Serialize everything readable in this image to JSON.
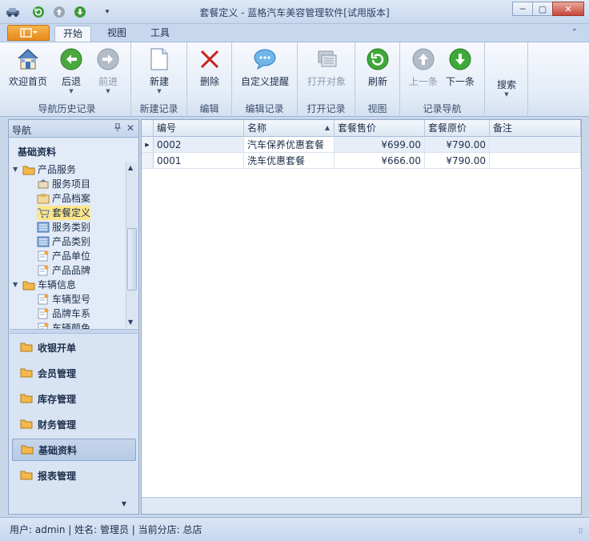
{
  "window": {
    "title": "套餐定义 - 蓝格汽车美容管理软件[试用版本]",
    "minimize_glyph": "─",
    "restore_glyph": "▢",
    "close_glyph": "✕"
  },
  "ribbon_tabs": [
    {
      "label": "开始",
      "active": true
    },
    {
      "label": "视图",
      "active": false
    },
    {
      "label": "工具",
      "active": false
    }
  ],
  "ribbon": {
    "groups": [
      {
        "label": "导航历史记录",
        "buttons": [
          {
            "label": "欢迎首页",
            "icon": "home-icon",
            "disabled": false
          },
          {
            "label": "后退",
            "icon": "back-arrow-icon",
            "disabled": false
          },
          {
            "label": "前进",
            "icon": "forward-arrow-icon",
            "disabled": true
          }
        ]
      },
      {
        "label": "新建记录",
        "buttons": [
          {
            "label": "新建",
            "icon": "new-document-icon",
            "disabled": false
          }
        ]
      },
      {
        "label": "编辑",
        "buttons": [
          {
            "label": "删除",
            "icon": "delete-x-icon",
            "disabled": false
          }
        ]
      },
      {
        "label": "编辑记录",
        "buttons": [
          {
            "label": "自定义提醒",
            "icon": "chat-bubble-icon",
            "disabled": false
          }
        ]
      },
      {
        "label": "打开记录",
        "buttons": [
          {
            "label": "打开对象",
            "icon": "open-object-icon",
            "disabled": true
          }
        ]
      },
      {
        "label": "视图",
        "buttons": [
          {
            "label": "刷新",
            "icon": "refresh-icon",
            "disabled": false
          }
        ]
      },
      {
        "label": "记录导航",
        "buttons": [
          {
            "label": "上一条",
            "icon": "up-arrow-icon",
            "disabled": true
          },
          {
            "label": "下一条",
            "icon": "down-arrow-icon",
            "disabled": false
          }
        ]
      },
      {
        "label": "",
        "buttons": [
          {
            "label": "搜索",
            "icon": "search-icon",
            "disabled": false
          }
        ]
      }
    ]
  },
  "nav_pane": {
    "title": "导航",
    "section_title": "基础资料",
    "tree": [
      {
        "label": "产品服务",
        "level": 0,
        "icon": "folder-icon",
        "selected": false
      },
      {
        "label": "服务项目",
        "level": 1,
        "icon": "service-item-icon",
        "selected": false
      },
      {
        "label": "产品档案",
        "level": 1,
        "icon": "product-file-icon",
        "selected": false
      },
      {
        "label": "套餐定义",
        "level": 1,
        "icon": "cart-icon",
        "selected": true
      },
      {
        "label": "服务类别",
        "level": 1,
        "icon": "category-icon",
        "selected": false
      },
      {
        "label": "产品类别",
        "level": 1,
        "icon": "category-icon",
        "selected": false
      },
      {
        "label": "产品单位",
        "level": 1,
        "icon": "document-star-icon",
        "selected": false
      },
      {
        "label": "产品品牌",
        "level": 1,
        "icon": "document-star-icon",
        "selected": false
      },
      {
        "label": "车辆信息",
        "level": 0,
        "icon": "folder-icon",
        "selected": false
      },
      {
        "label": "车辆型号",
        "level": 1,
        "icon": "document-star-icon",
        "selected": false
      },
      {
        "label": "品牌车系",
        "level": 1,
        "icon": "document-star-icon",
        "selected": false
      },
      {
        "label": "车辆颜色",
        "level": 1,
        "icon": "document-star-icon",
        "selected": false
      }
    ],
    "modules": [
      {
        "label": "收银开单",
        "active": false
      },
      {
        "label": "会员管理",
        "active": false
      },
      {
        "label": "库存管理",
        "active": false
      },
      {
        "label": "财务管理",
        "active": false
      },
      {
        "label": "基础资料",
        "active": true
      },
      {
        "label": "报表管理",
        "active": false
      }
    ]
  },
  "grid": {
    "columns": [
      "编号",
      "名称",
      "套餐售价",
      "套餐原价",
      "备注"
    ],
    "sorted_column": "名称",
    "rows": [
      {
        "code": "0002",
        "name": "汽车保养优惠套餐",
        "price": "¥699.00",
        "original": "¥790.00",
        "note": "",
        "current": true
      },
      {
        "code": "0001",
        "name": "洗车优惠套餐",
        "price": "¥666.00",
        "original": "¥790.00",
        "note": "",
        "current": false
      }
    ]
  },
  "status_bar": {
    "text": "用户: admin  |  姓名: 管理员  |  当前分店: 总店"
  },
  "colors": {
    "accent": "#e5891c",
    "ribbon_bg": "#e4ecf7",
    "frame": "#c9d7ea",
    "selection": "#fde68a"
  }
}
